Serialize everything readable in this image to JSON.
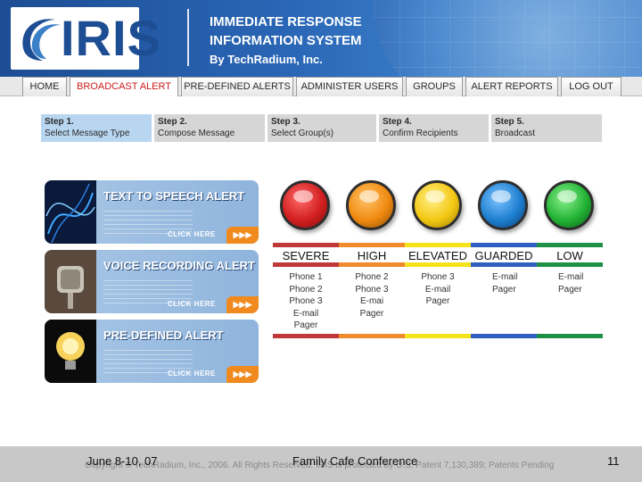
{
  "header": {
    "logo_text": "IRIS",
    "title_line1": "IMMEDIATE RESPONSE",
    "title_line2": "INFORMATION SYSTEM",
    "byline": "By TechRadium, Inc."
  },
  "nav": {
    "tabs": [
      {
        "label": "HOME"
      },
      {
        "label": "BROADCAST ALERT",
        "active": true
      },
      {
        "label": "PRE-DEFINED ALERTS"
      },
      {
        "label": "ADMINISTER USERS"
      },
      {
        "label": "GROUPS"
      },
      {
        "label": "ALERT REPORTS"
      },
      {
        "label": "LOG OUT"
      }
    ]
  },
  "steps": [
    {
      "number": "Step 1.",
      "label": "Select Message Type",
      "active": true
    },
    {
      "number": "Step 2.",
      "label": "Compose Message"
    },
    {
      "number": "Step 3.",
      "label": "Select Group(s)"
    },
    {
      "number": "Step 4.",
      "label": "Confirm Recipients"
    },
    {
      "number": "Step 5.",
      "label": "Broadcast"
    }
  ],
  "alert_types": [
    {
      "title": "TEXT TO SPEECH ALERT",
      "action": "CLICK HERE",
      "arrow": "▶▶▶"
    },
    {
      "title": "VOICE RECORDING ALERT",
      "action": "CLICK HERE",
      "arrow": "▶▶▶"
    },
    {
      "title": "PRE-DEFINED ALERT",
      "action": "CLICK HERE",
      "arrow": "▶▶▶"
    }
  ],
  "threat_levels": [
    {
      "name": "SEVERE",
      "color": "#d21f1f",
      "bar": "#c0383a",
      "channels": [
        "Phone 1",
        "Phone 2",
        "Phone 3",
        "E-mail",
        "Pager"
      ]
    },
    {
      "name": "HIGH",
      "color": "#f08a10",
      "bar": "#ef8a2d",
      "channels": [
        "Phone 2",
        "Phone 3",
        "E-mai",
        "Pager"
      ]
    },
    {
      "name": "ELEVATED",
      "color": "#f3c812",
      "bar": "#f4e21a",
      "channels": [
        "Phone 3",
        "E-mail",
        "Pager"
      ]
    },
    {
      "name": "GUARDED",
      "color": "#1e7fd0",
      "bar": "#2f5fc0",
      "channels": [
        "E-mail",
        "Pager"
      ]
    },
    {
      "name": "LOW",
      "color": "#22b334",
      "bar": "#1e9146",
      "channels": [
        "E-mail",
        "Pager"
      ]
    }
  ],
  "footer": {
    "copyright": "Copyright © TechRadium, Inc., 2006. All Rights Reserved. IRIS is protected by U.S. Patent 7,130,389; Patents Pending",
    "date": "June 8-10, 07",
    "event": "Family Cafe Conference",
    "page": "11"
  }
}
